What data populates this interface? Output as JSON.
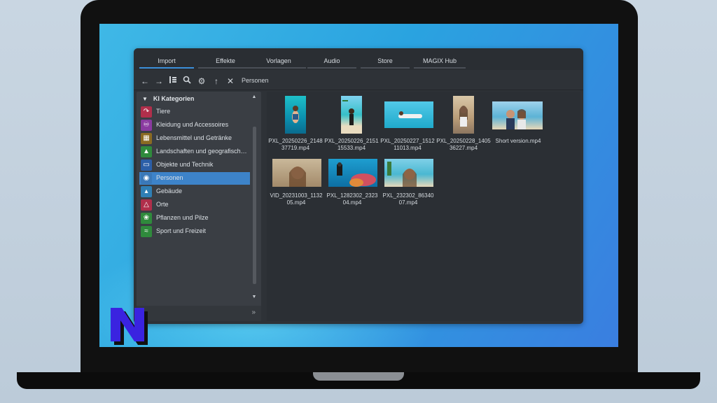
{
  "tabs": [
    {
      "label": "Import",
      "active": true
    },
    {
      "label": "Effekte",
      "active": false
    },
    {
      "label": "Vorlagen",
      "active": false
    },
    {
      "label": "Audio",
      "active": false
    },
    {
      "label": "Store",
      "active": false
    },
    {
      "label": "MAGIX Hub",
      "active": false
    }
  ],
  "toolbar": {
    "back_icon": "arrow-left-icon",
    "forward_icon": "arrow-right-icon",
    "view_icon": "list-view-icon",
    "search_icon": "search-icon",
    "settings_icon": "gear-icon",
    "up_icon": "arrow-up-icon",
    "close_icon": "close-icon",
    "breadcrumb": "Personen"
  },
  "sidebar": {
    "header": "KI Kategorien",
    "items": [
      {
        "label": "Tiere",
        "icon": "animal-icon",
        "color": "#b02f4b"
      },
      {
        "label": "Kleidung und Accessoires",
        "icon": "clothing-icon",
        "color": "#8a3aa0"
      },
      {
        "label": "Lebensmittel und Getränke",
        "icon": "basket-icon",
        "color": "#8a6a22"
      },
      {
        "label": "Landschaften und geografisch…",
        "icon": "landscape-icon",
        "color": "#2f8a3c"
      },
      {
        "label": "Objekte und Technik",
        "icon": "device-icon",
        "color": "#2c5fa8"
      },
      {
        "label": "Personen",
        "icon": "people-icon",
        "color": "#3a78b8",
        "active": true
      },
      {
        "label": "Gebäude",
        "icon": "building-icon",
        "color": "#2f7fb5"
      },
      {
        "label": "Orte",
        "icon": "place-icon",
        "color": "#b02f4b"
      },
      {
        "label": "Pflanzen und Pilze",
        "icon": "plant-icon",
        "color": "#2f8a3c"
      },
      {
        "label": "Sport und Freizeit",
        "icon": "sport-icon",
        "color": "#2f8a3c"
      }
    ]
  },
  "files": [
    {
      "name": "PXL_20250226_2148\n37719.mp4",
      "orientation": "portrait"
    },
    {
      "name": "PXL_20250226_2151\n15533.mp4",
      "orientation": "portrait"
    },
    {
      "name": "PXL_20250227_1512\n11013.mp4",
      "orientation": "landscape"
    },
    {
      "name": "PXL_20250228_1405\n36227.mp4",
      "orientation": "portrait"
    },
    {
      "name": "Short version.mp4",
      "orientation": "landscape"
    },
    {
      "name": "VID_20231003_1132\n05.mp4",
      "orientation": "landscape"
    },
    {
      "name": "PXL_1282302_2323\n04.mp4",
      "orientation": "landscape"
    },
    {
      "name": "PXL_232302_86340\n07.mp4",
      "orientation": "landscape"
    }
  ]
}
